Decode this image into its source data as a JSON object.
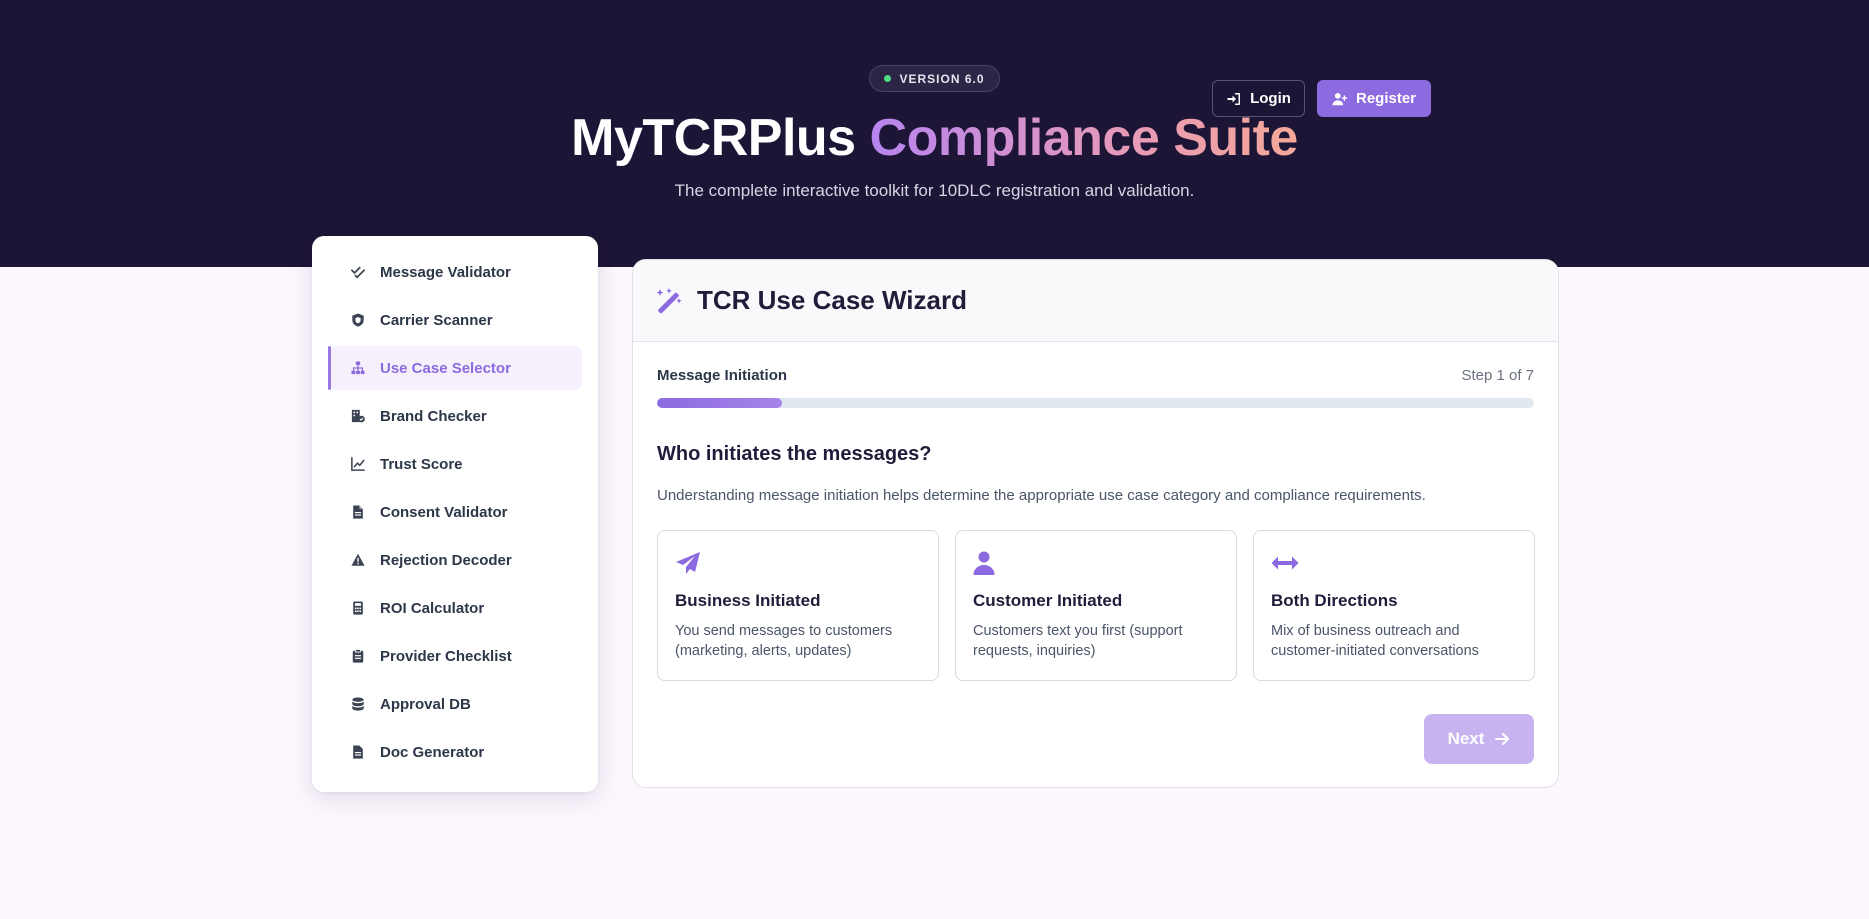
{
  "header": {
    "version_badge": "VERSION 6.0",
    "title_part1": "MyTCRPlus ",
    "title_part2": "Compliance Suite",
    "subtitle": "The complete interactive toolkit for 10DLC registration and validation.",
    "login_label": "Login",
    "register_label": "Register"
  },
  "sidebar": {
    "items": [
      {
        "label": "Message Validator",
        "icon": "double-check-icon"
      },
      {
        "label": "Carrier Scanner",
        "icon": "shield-icon"
      },
      {
        "label": "Use Case Selector",
        "icon": "sitemap-icon",
        "active": true
      },
      {
        "label": "Brand Checker",
        "icon": "building-check-icon"
      },
      {
        "label": "Trust Score",
        "icon": "line-chart-icon"
      },
      {
        "label": "Consent Validator",
        "icon": "file-icon"
      },
      {
        "label": "Rejection Decoder",
        "icon": "warning-icon"
      },
      {
        "label": "ROI Calculator",
        "icon": "calculator-icon"
      },
      {
        "label": "Provider Checklist",
        "icon": "clipboard-icon"
      },
      {
        "label": "Approval DB",
        "icon": "database-icon"
      },
      {
        "label": "Doc Generator",
        "icon": "file-icon"
      }
    ]
  },
  "wizard": {
    "title": "TCR Use Case Wizard",
    "progress_label": "Message Initiation",
    "step_text": "Step 1 of 7",
    "progress": 0.143,
    "question": "Who initiates the messages?",
    "description": "Understanding message initiation helps determine the appropriate use case category and compliance requirements.",
    "options": [
      {
        "title": "Business Initiated",
        "description": "You send messages to customers (marketing, alerts, updates)",
        "icon": "paper-plane-icon"
      },
      {
        "title": "Customer Initiated",
        "description": "Customers text you first (support requests, inquiries)",
        "icon": "user-icon"
      },
      {
        "title": "Both Directions",
        "description": "Mix of business outreach and customer-initiated conversations",
        "icon": "arrows-left-right-icon"
      }
    ],
    "next_label": "Next"
  },
  "colors": {
    "hero_bg": "#1d1535",
    "accent": "#8c6adf",
    "next_disabled": "#c7b3ef",
    "page_bg": "#fbf7fd"
  }
}
